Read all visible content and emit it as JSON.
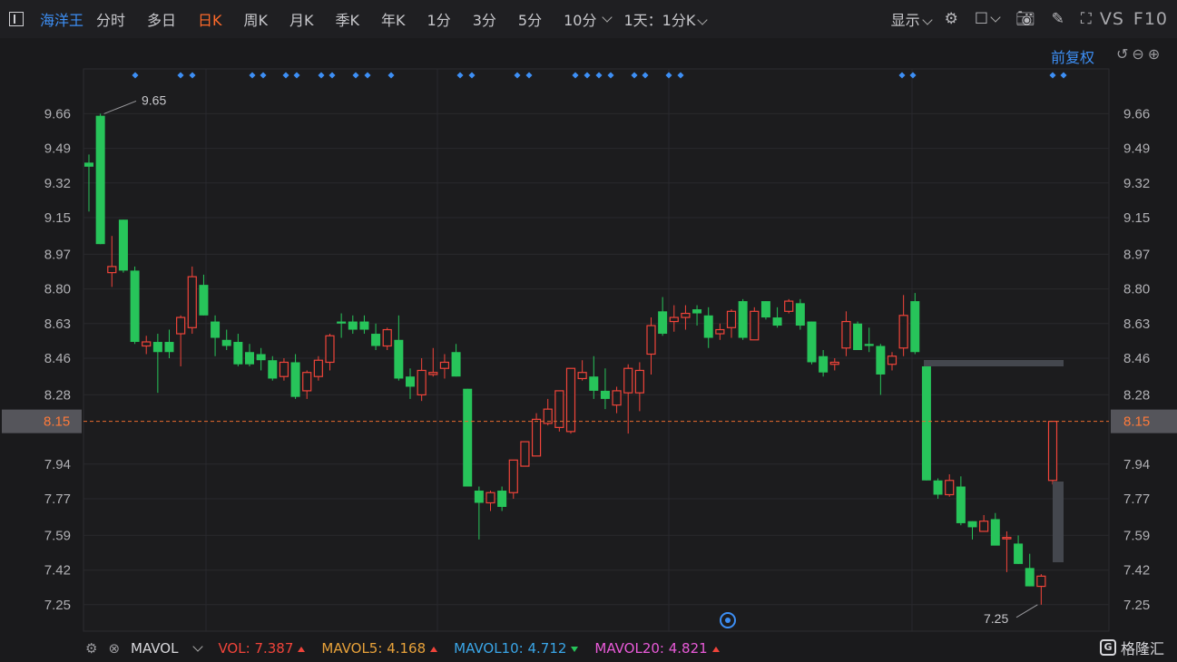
{
  "toolbar": {
    "stock_name": "海洋王",
    "tabs": [
      {
        "label": "分时",
        "active": false
      },
      {
        "label": "多日",
        "active": false
      },
      {
        "label": "日K",
        "active": true
      },
      {
        "label": "周K",
        "active": false
      },
      {
        "label": "月K",
        "active": false
      },
      {
        "label": "季K",
        "active": false
      },
      {
        "label": "年K",
        "active": false
      },
      {
        "label": "1分",
        "active": false
      },
      {
        "label": "3分",
        "active": false
      },
      {
        "label": "5分",
        "active": false
      },
      {
        "label": "10分",
        "active": false
      }
    ],
    "period_select": "1天：1分K",
    "display_label": "显示",
    "vs_label": "VS",
    "f10_label": "F10",
    "icons": [
      "gear-icon",
      "square-icon",
      "camera-icon",
      "pencil-icon",
      "fullscreen-icon"
    ]
  },
  "adjust_label": "前复权",
  "price_axis": {
    "ticks": [
      "9.66",
      "9.49",
      "9.32",
      "9.15",
      "8.97",
      "8.80",
      "8.63",
      "8.46",
      "8.28",
      "8.15",
      "7.94",
      "7.77",
      "7.59",
      "7.42",
      "7.25"
    ],
    "tick_values": [
      9.66,
      9.49,
      9.32,
      9.15,
      8.97,
      8.8,
      8.63,
      8.46,
      8.28,
      7.94,
      7.77,
      7.59,
      7.42,
      7.25
    ],
    "current_price": "8.15",
    "current_value": 8.15
  },
  "annotations": {
    "high_label": "9.65",
    "low_label": "7.25"
  },
  "colors": {
    "up": "#f0443a",
    "down": "#27c45a",
    "accent": "#3d8ff5",
    "active_tab": "#ff6a2a",
    "price_line": "#e86a2e"
  },
  "chart_data": {
    "type": "candlestick",
    "ylim": [
      7.12,
      9.88
    ],
    "candles": [
      {
        "o": 9.42,
        "h": 9.46,
        "l": 9.18,
        "c": 9.4
      },
      {
        "o": 9.65,
        "h": 9.66,
        "l": 9.02,
        "c": 9.02
      },
      {
        "o": 8.88,
        "h": 9.06,
        "l": 8.81,
        "c": 8.91
      },
      {
        "o": 9.14,
        "h": 9.14,
        "l": 8.88,
        "c": 8.89
      },
      {
        "o": 8.89,
        "h": 8.91,
        "l": 8.53,
        "c": 8.54
      },
      {
        "o": 8.52,
        "h": 8.57,
        "l": 8.48,
        "c": 8.54
      },
      {
        "o": 8.54,
        "h": 8.58,
        "l": 8.29,
        "c": 8.49
      },
      {
        "o": 8.54,
        "h": 8.6,
        "l": 8.46,
        "c": 8.49
      },
      {
        "o": 8.58,
        "h": 8.67,
        "l": 8.42,
        "c": 8.66
      },
      {
        "o": 8.61,
        "h": 8.91,
        "l": 8.58,
        "c": 8.86
      },
      {
        "o": 8.82,
        "h": 8.87,
        "l": 8.67,
        "c": 8.67
      },
      {
        "o": 8.64,
        "h": 8.67,
        "l": 8.47,
        "c": 8.56
      },
      {
        "o": 8.55,
        "h": 8.6,
        "l": 8.5,
        "c": 8.52
      },
      {
        "o": 8.54,
        "h": 8.58,
        "l": 8.42,
        "c": 8.43
      },
      {
        "o": 8.49,
        "h": 8.53,
        "l": 8.42,
        "c": 8.43
      },
      {
        "o": 8.48,
        "h": 8.51,
        "l": 8.4,
        "c": 8.45
      },
      {
        "o": 8.45,
        "h": 8.47,
        "l": 8.35,
        "c": 8.36
      },
      {
        "o": 8.37,
        "h": 8.46,
        "l": 8.35,
        "c": 8.44
      },
      {
        "o": 8.44,
        "h": 8.48,
        "l": 8.26,
        "c": 8.27
      },
      {
        "o": 8.3,
        "h": 8.4,
        "l": 8.26,
        "c": 8.39
      },
      {
        "o": 8.37,
        "h": 8.47,
        "l": 8.35,
        "c": 8.45
      },
      {
        "o": 8.44,
        "h": 8.58,
        "l": 8.4,
        "c": 8.57
      },
      {
        "o": 8.64,
        "h": 8.68,
        "l": 8.56,
        "c": 8.63
      },
      {
        "o": 8.64,
        "h": 8.67,
        "l": 8.58,
        "c": 8.6
      },
      {
        "o": 8.64,
        "h": 8.67,
        "l": 8.58,
        "c": 8.6
      },
      {
        "o": 8.58,
        "h": 8.63,
        "l": 8.5,
        "c": 8.52
      },
      {
        "o": 8.52,
        "h": 8.61,
        "l": 8.5,
        "c": 8.6
      },
      {
        "o": 8.55,
        "h": 8.67,
        "l": 8.35,
        "c": 8.36
      },
      {
        "o": 8.37,
        "h": 8.41,
        "l": 8.26,
        "c": 8.32
      },
      {
        "o": 8.28,
        "h": 8.46,
        "l": 8.25,
        "c": 8.4
      },
      {
        "o": 8.38,
        "h": 8.51,
        "l": 8.37,
        "c": 8.39
      },
      {
        "o": 8.41,
        "h": 8.48,
        "l": 8.36,
        "c": 8.44
      },
      {
        "o": 8.49,
        "h": 8.53,
        "l": 8.37,
        "c": 8.37
      },
      {
        "o": 8.31,
        "h": 8.31,
        "l": 7.83,
        "c": 7.83
      },
      {
        "o": 7.81,
        "h": 7.83,
        "l": 7.57,
        "c": 7.75
      },
      {
        "o": 7.75,
        "h": 7.81,
        "l": 7.71,
        "c": 7.8
      },
      {
        "o": 7.81,
        "h": 7.83,
        "l": 7.71,
        "c": 7.73
      },
      {
        "o": 7.8,
        "h": 7.96,
        "l": 7.77,
        "c": 7.96
      },
      {
        "o": 7.93,
        "h": 8.05,
        "l": 7.93,
        "c": 8.05
      },
      {
        "o": 7.98,
        "h": 8.19,
        "l": 7.98,
        "c": 8.16
      },
      {
        "o": 8.14,
        "h": 8.26,
        "l": 8.13,
        "c": 8.21
      },
      {
        "o": 8.12,
        "h": 8.3,
        "l": 8.1,
        "c": 8.3
      },
      {
        "o": 8.1,
        "h": 8.41,
        "l": 8.09,
        "c": 8.41
      },
      {
        "o": 8.36,
        "h": 8.45,
        "l": 8.35,
        "c": 8.39
      },
      {
        "o": 8.37,
        "h": 8.47,
        "l": 8.26,
        "c": 8.3
      },
      {
        "o": 8.3,
        "h": 8.41,
        "l": 8.21,
        "c": 8.26
      },
      {
        "o": 8.23,
        "h": 8.32,
        "l": 8.19,
        "c": 8.3
      },
      {
        "o": 8.29,
        "h": 8.43,
        "l": 8.09,
        "c": 8.41
      },
      {
        "o": 8.29,
        "h": 8.44,
        "l": 8.2,
        "c": 8.4
      },
      {
        "o": 8.48,
        "h": 8.66,
        "l": 8.38,
        "c": 8.62
      },
      {
        "o": 8.69,
        "h": 8.76,
        "l": 8.57,
        "c": 8.58
      },
      {
        "o": 8.64,
        "h": 8.72,
        "l": 8.59,
        "c": 8.66
      },
      {
        "o": 8.66,
        "h": 8.72,
        "l": 8.6,
        "c": 8.68
      },
      {
        "o": 8.7,
        "h": 8.72,
        "l": 8.62,
        "c": 8.68
      },
      {
        "o": 8.67,
        "h": 8.71,
        "l": 8.51,
        "c": 8.56
      },
      {
        "o": 8.58,
        "h": 8.63,
        "l": 8.55,
        "c": 8.6
      },
      {
        "o": 8.61,
        "h": 8.7,
        "l": 8.56,
        "c": 8.69
      },
      {
        "o": 8.74,
        "h": 8.75,
        "l": 8.55,
        "c": 8.56
      },
      {
        "o": 8.55,
        "h": 8.71,
        "l": 8.55,
        "c": 8.69
      },
      {
        "o": 8.74,
        "h": 8.74,
        "l": 8.65,
        "c": 8.66
      },
      {
        "o": 8.66,
        "h": 8.71,
        "l": 8.61,
        "c": 8.62
      },
      {
        "o": 8.69,
        "h": 8.75,
        "l": 8.68,
        "c": 8.74
      },
      {
        "o": 8.73,
        "h": 8.75,
        "l": 8.6,
        "c": 8.62
      },
      {
        "o": 8.64,
        "h": 8.64,
        "l": 8.43,
        "c": 8.44
      },
      {
        "o": 8.47,
        "h": 8.5,
        "l": 8.37,
        "c": 8.39
      },
      {
        "o": 8.43,
        "h": 8.46,
        "l": 8.4,
        "c": 8.44
      },
      {
        "o": 8.51,
        "h": 8.69,
        "l": 8.47,
        "c": 8.64
      },
      {
        "o": 8.63,
        "h": 8.64,
        "l": 8.5,
        "c": 8.5
      },
      {
        "o": 8.53,
        "h": 8.61,
        "l": 8.49,
        "c": 8.52
      },
      {
        "o": 8.52,
        "h": 8.53,
        "l": 8.28,
        "c": 8.38
      },
      {
        "o": 8.43,
        "h": 8.49,
        "l": 8.4,
        "c": 8.47
      },
      {
        "o": 8.51,
        "h": 8.77,
        "l": 8.47,
        "c": 8.67
      },
      {
        "o": 8.74,
        "h": 8.78,
        "l": 8.48,
        "c": 8.49
      },
      {
        "o": 8.42,
        "h": 8.42,
        "l": 7.86,
        "c": 7.86
      },
      {
        "o": 7.86,
        "h": 7.87,
        "l": 7.77,
        "c": 7.79
      },
      {
        "o": 7.79,
        "h": 7.89,
        "l": 7.78,
        "c": 7.86
      },
      {
        "o": 7.83,
        "h": 7.88,
        "l": 7.64,
        "c": 7.65
      },
      {
        "o": 7.66,
        "h": 7.66,
        "l": 7.57,
        "c": 7.63
      },
      {
        "o": 7.61,
        "h": 7.69,
        "l": 7.61,
        "c": 7.66
      },
      {
        "o": 7.67,
        "h": 7.7,
        "l": 7.56,
        "c": 7.54
      },
      {
        "o": 7.58,
        "h": 7.61,
        "l": 7.41,
        "c": 7.58
      },
      {
        "o": 7.55,
        "h": 7.59,
        "l": 7.45,
        "c": 7.45
      },
      {
        "o": 7.43,
        "h": 7.5,
        "l": 7.34,
        "c": 7.34
      },
      {
        "o": 7.34,
        "h": 7.4,
        "l": 7.25,
        "c": 7.39
      },
      {
        "o": 7.86,
        "h": 8.15,
        "l": 7.84,
        "c": 8.15
      }
    ]
  },
  "volume_bar": {
    "label": "MAVOL",
    "vol_label": "VOL:",
    "vol_value": "7.387",
    "ma5_label": "MAVOL5:",
    "ma5_value": "4.168",
    "ma10_label": "MAVOL10:",
    "ma10_value": "4.712",
    "ma20_label": "MAVOL20:",
    "ma20_value": "4.821"
  },
  "brand": "格隆汇"
}
